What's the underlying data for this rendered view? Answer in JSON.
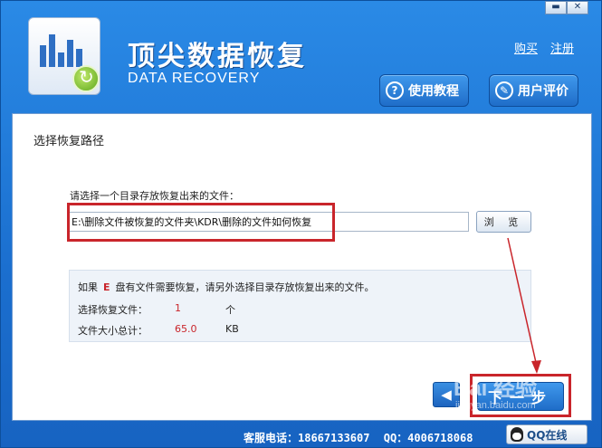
{
  "window": {
    "title": "顶尖数据恢复",
    "subtitle": "DATA RECOVERY",
    "minimize_label": "▬",
    "close_label": "✕"
  },
  "header": {
    "links": [
      "购买",
      "注册"
    ],
    "tutorial_label": "使用教程",
    "review_label": "用户评价"
  },
  "main": {
    "section_title": "选择恢复路径",
    "path_label": "请选择一个目录存放恢复出来的文件：",
    "path_value": "E:\\删除文件被恢复的文件夹\\KDR\\删除的文件如何恢复",
    "browse_label": "浏 览",
    "notice_prefix": "如果",
    "notice_drive": "E",
    "notice_suffix": "盘有文件需要恢复，请另外选择目录存放恢复出来的文件。",
    "rows": [
      {
        "label": "选择恢复文件：",
        "value": "1",
        "unit": "个"
      },
      {
        "label": "文件大小总计：",
        "value": "65.0",
        "unit": "KB"
      }
    ],
    "back_label": "◀",
    "next_label": "下一步"
  },
  "footer": {
    "phone_label": "客服电话：18667133607",
    "qq_label": "QQ：4006718068",
    "qq_online_label": "QQ在线"
  },
  "watermark": {
    "text": "Bai 经验",
    "sub": "jingyan.baidu.com"
  },
  "colors": {
    "accent_blue": "#1f6dc8",
    "highlight_red": "#c9252b"
  }
}
